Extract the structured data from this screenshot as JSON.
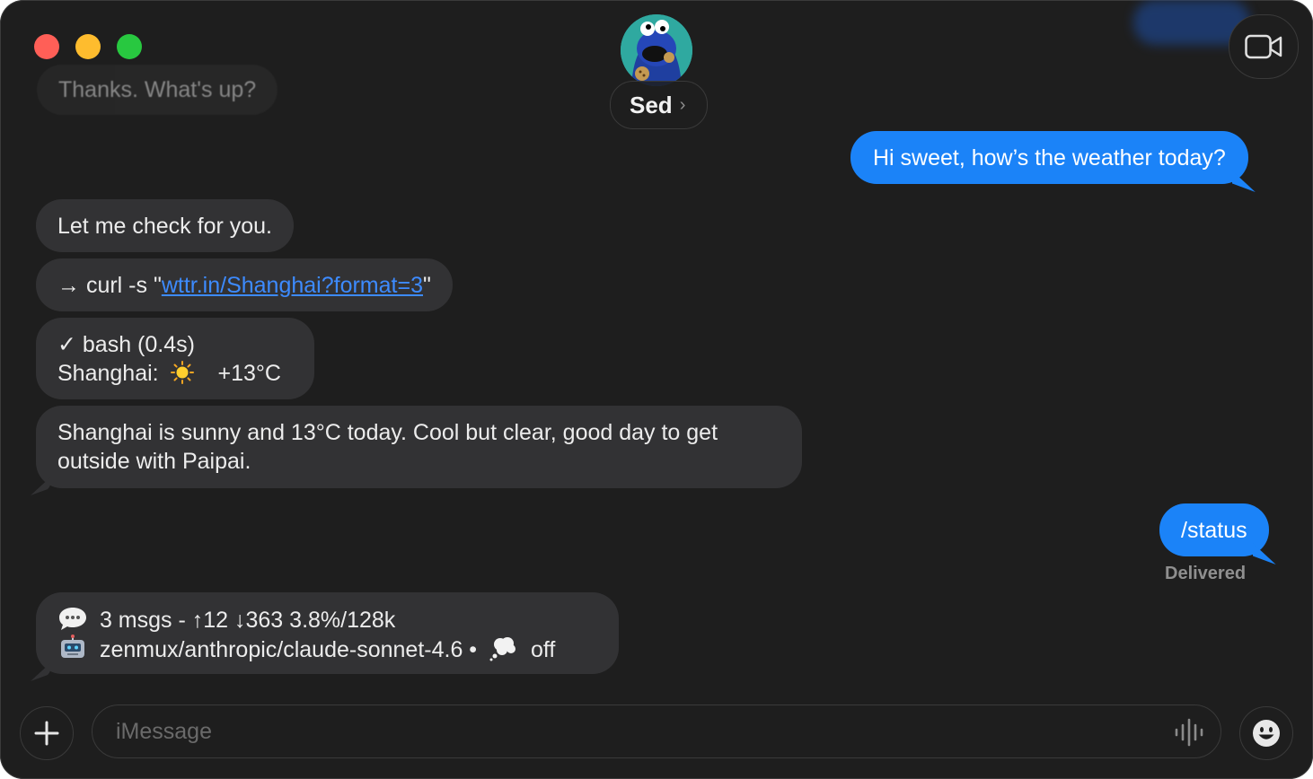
{
  "header": {
    "contact_name": "Sed",
    "chevron": "›",
    "avatar_icon": "cookie-monster-avatar-icon"
  },
  "faded_message": "Thanks. What's up?",
  "messages": [
    {
      "side": "out",
      "text": "Hi sweet, how’s the weather today?"
    },
    {
      "side": "in",
      "text": "Let me check for you."
    },
    {
      "side": "in",
      "prefix": "→ curl -s \"",
      "link": "wttr.in/Shanghai?format=3",
      "suffix": "\""
    },
    {
      "side": "in",
      "line1": "✓ bash (0.4s)",
      "line2_prefix": "Shanghai:",
      "line2_icon": "sun-icon",
      "line2_suffix": "+13°C"
    },
    {
      "side": "in",
      "line1": "Shanghai is sunny and 13°C today. Cool but clear, good day to get",
      "line2": "outside with Paipai."
    },
    {
      "side": "out",
      "text": "/status"
    },
    {
      "side": "in",
      "line1_icon": "speech-bubble-icon",
      "line1": "3 msgs - ↑12 ↓363 3.8%/128k",
      "line2_icon": "robot-icon",
      "line2": "zenmux/anthropic/claude-sonnet-4.6 •",
      "line2_icon2": "thought-bubble-icon",
      "line2_suffix": "off"
    }
  ],
  "status_text": "Delivered",
  "composer": {
    "placeholder": "iMessage",
    "value": ""
  },
  "colors": {
    "background": "#1e1e1e",
    "incoming_bubble": "#323234",
    "outgoing_bubble": "#1b83f8",
    "link": "#3d8bff"
  }
}
